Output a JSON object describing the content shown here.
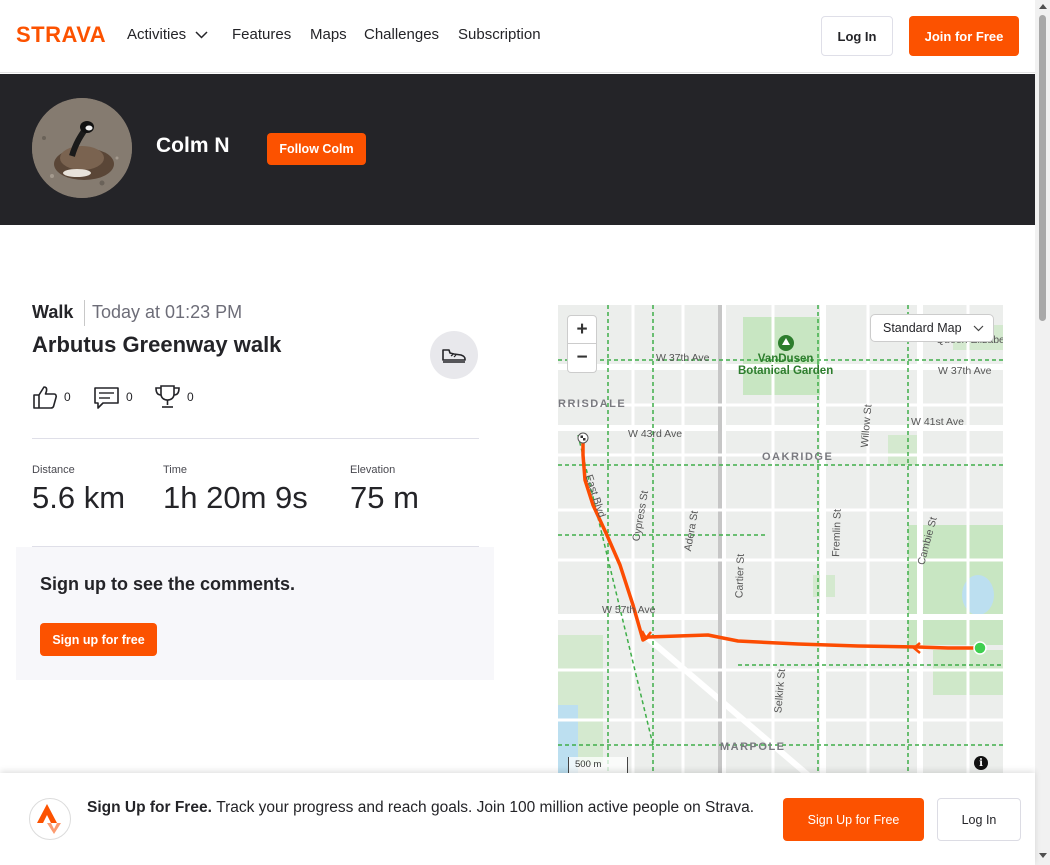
{
  "brand": {
    "name": "STRAVA",
    "color": "#fc5200"
  },
  "nav": {
    "activities": "Activities",
    "features": "Features",
    "maps": "Maps",
    "challenges": "Challenges",
    "subscription": "Subscription",
    "login": "Log In",
    "join": "Join for Free"
  },
  "athlete": {
    "name": "Colm N",
    "follow_label": "Follow Colm"
  },
  "activity": {
    "type": "Walk",
    "date": "Today at 01:23 PM",
    "title": "Arbutus Greenway walk",
    "kudos_count": "0",
    "comments_count": "0",
    "achievements_count": "0",
    "stats": [
      {
        "label": "Distance",
        "value": "5.6 km"
      },
      {
        "label": "Time",
        "value": "1h 20m 9s"
      },
      {
        "label": "Elevation",
        "value": "75 m"
      }
    ]
  },
  "comments": {
    "prompt": "Sign up to see the comments.",
    "signup_label": "Sign up for free"
  },
  "map": {
    "style": "Standard Map",
    "zoom_in": "+",
    "zoom_out": "−",
    "scale": "500 m",
    "info": "i",
    "streets": {
      "w37": "W 37th Ave",
      "w37_right": "W 37th Ave",
      "queen": "Queen Elizabeth",
      "w41": "W 41st Ave",
      "w43": "W 43rd Ave",
      "w57": "W 57th Ave",
      "east_blvd": "East Blvd",
      "cypress": "Cypress St",
      "adera": "Adera St",
      "willow": "Willow St",
      "cartier": "Cartier St",
      "franklin": "Fremlin St",
      "cambie": "Cambie St",
      "selkirk": "Selkirk St"
    },
    "poi": {
      "vandusen": "VanDusen\nBotanical Garden"
    },
    "areas": {
      "kerrisdale": "RRISDALE",
      "oakridge": "OAKRIDGE",
      "marpole": "MARPOLE"
    },
    "route_color": "#fc4c02"
  },
  "signup_bar": {
    "headline": "Sign Up for Free.",
    "body": "Track your progress and reach goals. Join 100 million active people on Strava.",
    "signup_label": "Sign Up for Free",
    "login_label": "Log In"
  }
}
